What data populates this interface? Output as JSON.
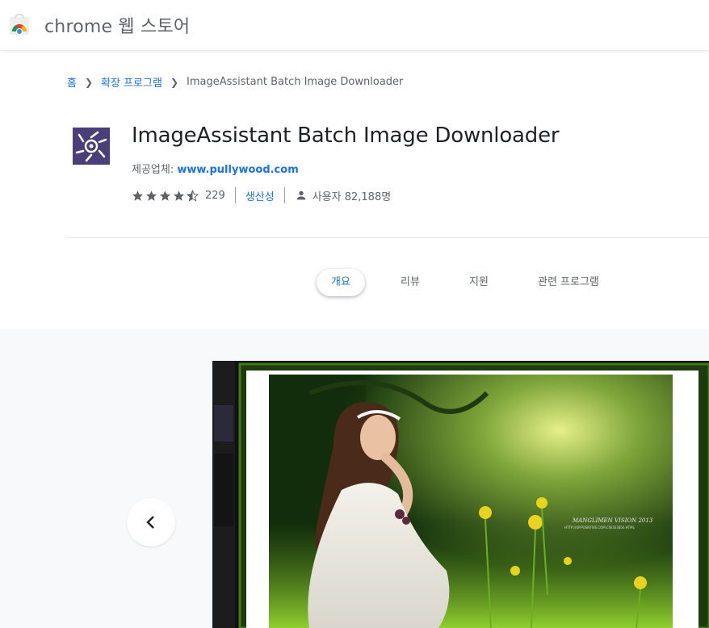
{
  "header": {
    "title": "chrome 웹 스토어",
    "logo": "chrome-web-store-logo"
  },
  "breadcrumb": {
    "home": "홈",
    "section": "확장 프로그램",
    "current": "ImageAssistant Batch Image Downloader"
  },
  "extension": {
    "name": "ImageAssistant Batch Image Downloader",
    "provider_label": "제공업체: ",
    "provider_link": "www.pullywood.com",
    "rating": 4.5,
    "rating_count": "229",
    "category": "생산성",
    "users": "사용자 82,188명",
    "icon_color": "#4b3f7a"
  },
  "tabs": [
    {
      "label": "개요",
      "active": true
    },
    {
      "label": "리뷰",
      "active": false
    },
    {
      "label": "지원",
      "active": false
    },
    {
      "label": "관련 프로그램",
      "active": false
    }
  ],
  "gallery": {
    "prev_icon": "chevron-left-icon",
    "watermark_line1": "MANGLIMEN VISION 2013",
    "watermark_line2": "HTTP://XP.POSNTIVE.COM.CN/343856.HTML"
  },
  "colors": {
    "link": "#1a73e8",
    "secondary_text": "#5f6368",
    "star": "#5f6368"
  }
}
